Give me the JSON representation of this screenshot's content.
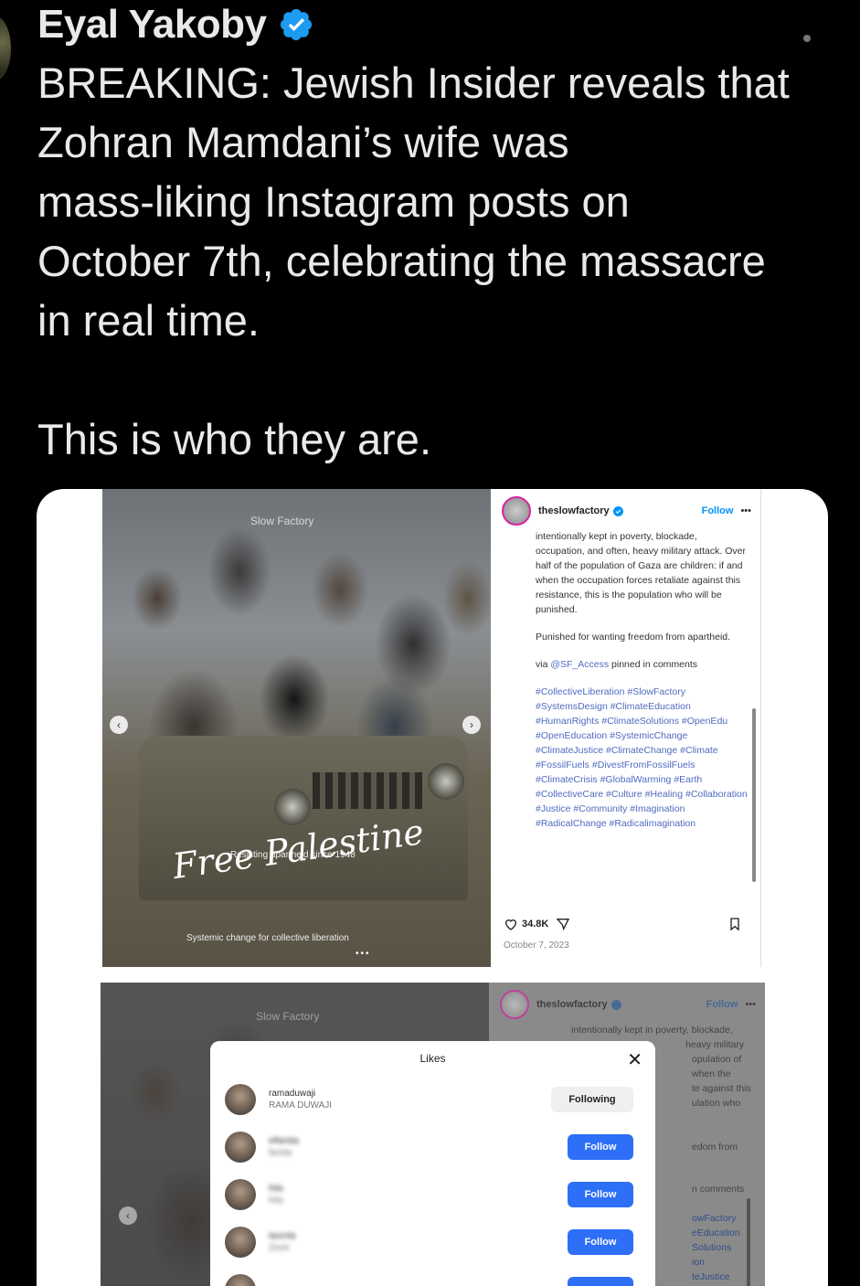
{
  "tweet": {
    "author": "Eyal Yakoby",
    "text_line1": "BREAKING: Jewish Insider reveals that",
    "text_line2": "Zohran Mamdani’s wife was",
    "text_line3": "mass-liking Instagram posts on",
    "text_line4": "October 7th, celebrating the massacre",
    "text_line5": "in real time.",
    "text_line6": "This is who they are."
  },
  "screenshot_top": {
    "watermark": "Slow Factory",
    "overlay_script": "Free Palestine",
    "overlay_small": "Resisting apartheid since 1948",
    "caption": "Systemic change for collective liberation",
    "dots": "•••",
    "prev_arrow": "‹",
    "next_arrow": "›",
    "account": "theslowfactory",
    "follow": "Follow",
    "more": "•••",
    "body_p1": "intentionally kept in poverty, blockade, occupation, and often, heavy military attack. Over half of the population of Gaza are children: if and when the occupation forces retaliate against this resistance, this is the population who will be punished.",
    "body_p2": "Punished for wanting freedom from apartheid.",
    "via_prefix": "via",
    "via_handle": "@SF_Access",
    "via_suffix": "pinned in comments",
    "hashtags": "#CollectiveLiberation #SlowFactory #SystemsDesign #ClimateEducation #HumanRights #ClimateSolutions #OpenEdu #OpenEducation #SystemicChange #ClimateJustice #ClimateChange #Climate #FossilFuels #DivestFromFossilFuels #ClimateCrisis #GlobalWarming #Earth #CollectiveCare #Culture #Healing #Collaboration #Justice #Community #Imagination #RadicalChange #Radicalimagination",
    "likes_count": "34.8K",
    "date": "October 7, 2023"
  },
  "screenshot_bottom": {
    "watermark": "Slow Factory",
    "account": "theslowfactory",
    "follow": "Follow",
    "more": "•••",
    "peek_1": "intentionally kept in poverty, blockade,",
    "peek_2": "heavy military",
    "peek_3": "opulation of",
    "peek_4": "when the",
    "peek_5": "te against this",
    "peek_6": "ulation who",
    "peek_7": "edom from",
    "peek_8": "n comments",
    "peek_9": "owFactory",
    "peek_10": "eEducation",
    "peek_11": "Solutions",
    "peek_12": "ion",
    "peek_13": "teJustice",
    "prev_arrow": "‹",
    "likes_modal": {
      "title": "Likes",
      "close": "✕",
      "rows": [
        {
          "username": "ramaduwaji",
          "fullname": "RAMA DUWAJI",
          "button": "Following"
        },
        {
          "username": "elfarida",
          "fullname": "farida",
          "button": "Follow"
        },
        {
          "username": "hila",
          "fullname": "hila",
          "button": "Follow"
        },
        {
          "username": "laomla",
          "fullname": "Zeeti",
          "button": "Follow"
        }
      ]
    }
  }
}
